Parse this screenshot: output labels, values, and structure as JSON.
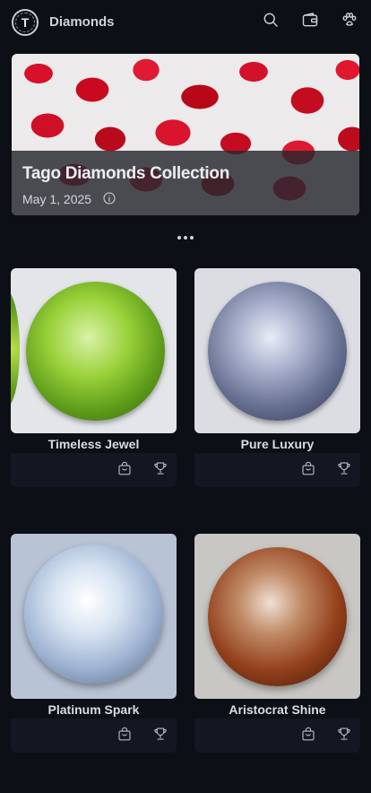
{
  "header": {
    "logo_letter": "T",
    "title": "Diamonds",
    "icons": [
      "search-icon",
      "wallet-icon",
      "paw-icon"
    ]
  },
  "hero": {
    "title": "Tago Diamonds Collection",
    "date": "May 1, 2025",
    "info_icon": "info-icon"
  },
  "cards": [
    {
      "name": "Timeless Jewel",
      "gem_color": "#7fbf2a",
      "bg_color": "#e4e6ea"
    },
    {
      "name": "Pure Luxury",
      "gem_color": "#6a7394",
      "bg_color": "#dcdde2"
    },
    {
      "name": "Platinum Spark",
      "gem_color": "#a9bfdc",
      "bg_color": "#b9c4d6"
    },
    {
      "name": "Aristocrat Shine",
      "gem_color": "#a34a20",
      "bg_color": "#c9c8c6"
    }
  ],
  "card_icons": [
    "bag-icon",
    "trophy-icon"
  ]
}
